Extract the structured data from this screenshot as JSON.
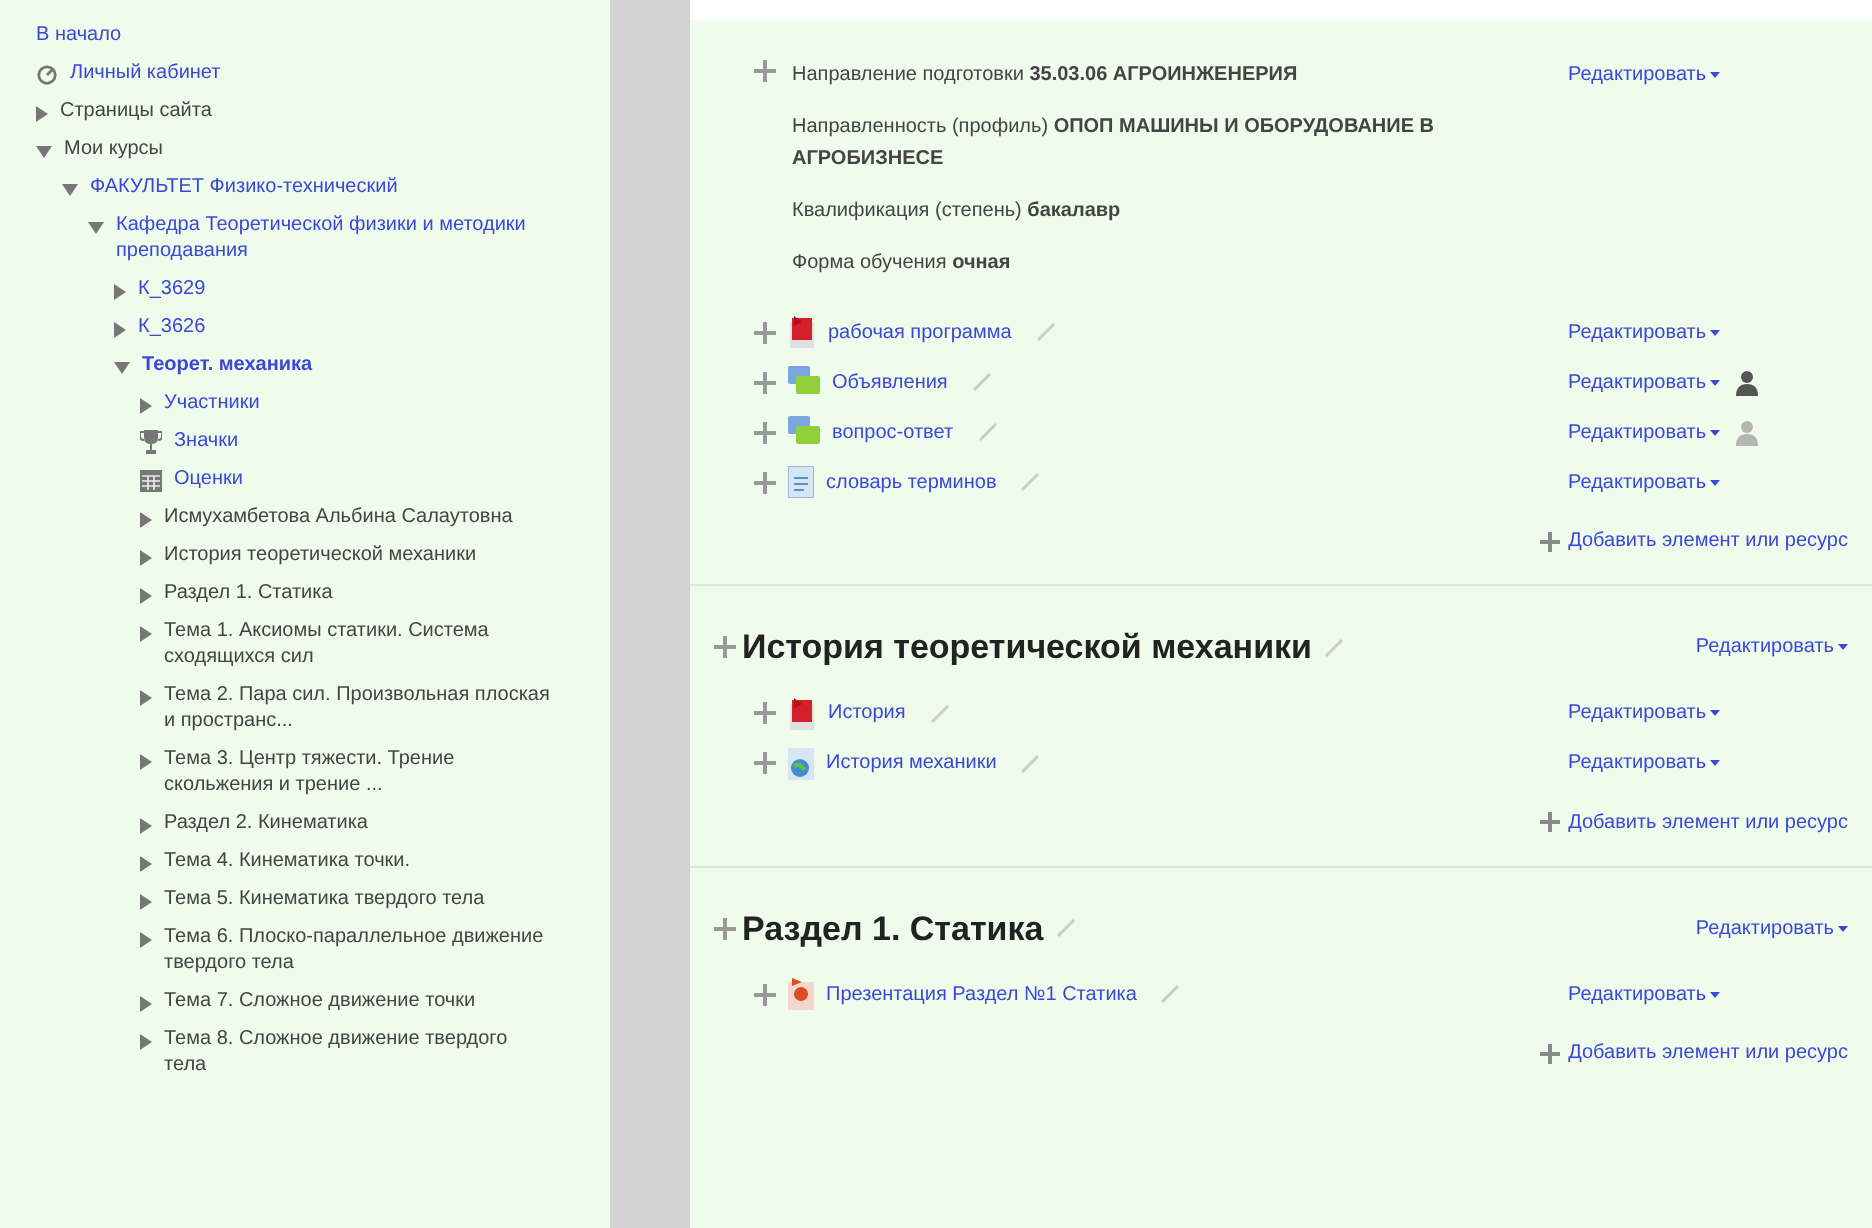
{
  "nav": [
    {
      "label": "В начало",
      "kind": "plain",
      "link": true,
      "current": false
    },
    {
      "label": "Личный кабинет",
      "kind": "dashboard",
      "link": true,
      "current": false
    },
    {
      "label": "Страницы сайта",
      "kind": "toggle",
      "expanded": false,
      "link": false,
      "current": false
    },
    {
      "label": "Мои курсы",
      "kind": "toggle",
      "expanded": true,
      "link": false,
      "current": false,
      "children": [
        {
          "label": "ФАКУЛЬТЕТ Физико-технический",
          "kind": "toggle",
          "expanded": true,
          "link": true,
          "current": false,
          "children": [
            {
              "label": "Кафедра Теоретической физики и методики преподавания",
              "kind": "toggle",
              "expanded": true,
              "link": true,
              "current": false,
              "children": [
                {
                  "label": "К_3629",
                  "kind": "toggle",
                  "expanded": false,
                  "link": true,
                  "current": false
                },
                {
                  "label": "К_3626",
                  "kind": "toggle",
                  "expanded": false,
                  "link": true,
                  "current": false
                },
                {
                  "label": "Теорет. механика",
                  "kind": "toggle",
                  "expanded": true,
                  "link": true,
                  "current": true,
                  "children": [
                    {
                      "label": "Участники",
                      "kind": "toggle",
                      "expanded": false,
                      "link": true,
                      "current": false
                    },
                    {
                      "label": "Значки",
                      "kind": "trophy",
                      "link": true,
                      "current": false
                    },
                    {
                      "label": "Оценки",
                      "kind": "grades",
                      "link": true,
                      "current": false
                    },
                    {
                      "label": "Исмухамбетова Альбина Салаутовна",
                      "kind": "toggle",
                      "expanded": false,
                      "link": false,
                      "current": false
                    },
                    {
                      "label": "История теоретической механики",
                      "kind": "toggle",
                      "expanded": false,
                      "link": false,
                      "current": false
                    },
                    {
                      "label": "Раздел 1. Статика",
                      "kind": "toggle",
                      "expanded": false,
                      "link": false,
                      "current": false
                    },
                    {
                      "label": "Тема 1. Аксиомы статики. Система сходящихся сил",
                      "kind": "toggle",
                      "expanded": false,
                      "link": false,
                      "current": false
                    },
                    {
                      "label": "Тема 2. Пара сил. Произвольная плоская и пространс...",
                      "kind": "toggle",
                      "expanded": false,
                      "link": false,
                      "current": false
                    },
                    {
                      "label": "Тема 3. Центр тяжести. Трение скольжения и трение ...",
                      "kind": "toggle",
                      "expanded": false,
                      "link": false,
                      "current": false
                    },
                    {
                      "label": "Раздел 2. Кинематика",
                      "kind": "toggle",
                      "expanded": false,
                      "link": false,
                      "current": false
                    },
                    {
                      "label": "Тема 4. Кинематика точки.",
                      "kind": "toggle",
                      "expanded": false,
                      "link": false,
                      "current": false
                    },
                    {
                      "label": "Тема 5. Кинематика твердого тела",
                      "kind": "toggle",
                      "expanded": false,
                      "link": false,
                      "current": false
                    },
                    {
                      "label": "Тема 6. Плоско-параллельное движение твердого тела",
                      "kind": "toggle",
                      "expanded": false,
                      "link": false,
                      "current": false
                    },
                    {
                      "label": "Тема 7. Сложное движение точки",
                      "kind": "toggle",
                      "expanded": false,
                      "link": false,
                      "current": false
                    },
                    {
                      "label": "Тема 8. Сложное движение твердого тела",
                      "kind": "toggle",
                      "expanded": false,
                      "link": false,
                      "current": false
                    }
                  ]
                }
              ]
            }
          ]
        }
      ]
    }
  ],
  "sections": [
    {
      "edit": "Редактировать",
      "summary": [
        "Направление подготовки **35.03.06 АГРОИНЖЕНЕРИЯ**",
        "Направленность (профиль) **ОПОП МАШИНЫ И ОБОРУДОВАНИЕ В АГРОБИЗНЕСЕ**",
        "Квалификация (степень) **бакалавр**",
        "Форма обучения **очная**"
      ],
      "activities": [
        {
          "kind": "pdf",
          "title": "рабочая программа",
          "edit": "Редактировать",
          "group_icon": false
        },
        {
          "kind": "forum",
          "title": "Объявления",
          "edit": "Редактировать",
          "group_icon": true,
          "group_dimmed": false
        },
        {
          "kind": "forum",
          "title": "вопрос-ответ",
          "edit": "Редактировать",
          "group_icon": true,
          "group_dimmed": true
        },
        {
          "kind": "glossary",
          "title": "словарь терминов",
          "edit": "Редактировать",
          "group_icon": false
        }
      ],
      "add": "Добавить элемент или ресурс"
    },
    {
      "title": "История теоретической механики",
      "edit": "Редактировать",
      "activities": [
        {
          "kind": "pdf",
          "title": "История",
          "edit": "Редактировать",
          "group_icon": false
        },
        {
          "kind": "url",
          "title": "История механики",
          "edit": "Редактировать",
          "group_icon": false
        }
      ],
      "add": "Добавить элемент или ресурс"
    },
    {
      "title": "Раздел 1. Статика",
      "edit": "Редактировать",
      "activities": [
        {
          "kind": "ppt",
          "title": "Презентация Раздел №1 Статика",
          "edit": "Редактировать",
          "group_icon": false
        }
      ],
      "add": "Добавить элемент или ресурс"
    }
  ]
}
